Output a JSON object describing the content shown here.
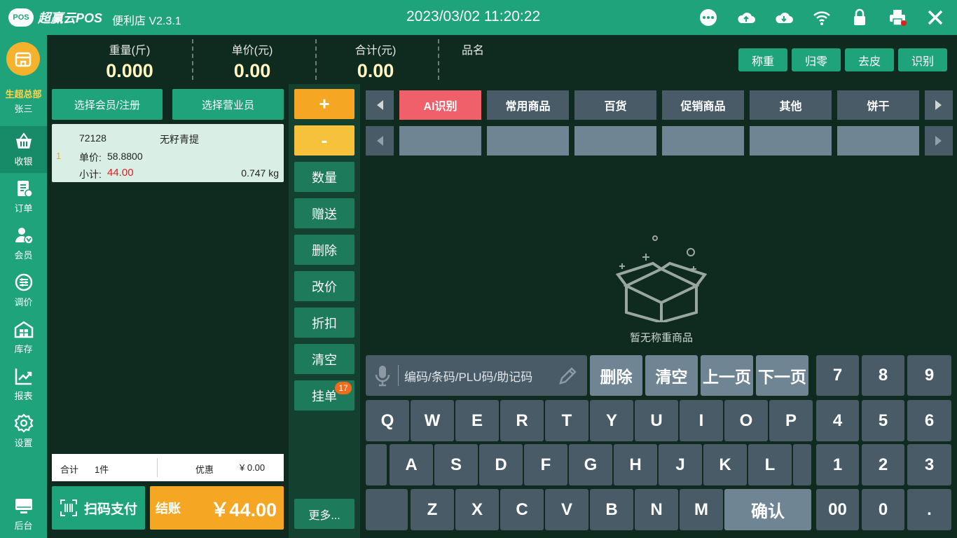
{
  "app": {
    "logo_badge": "POS",
    "name": "超赢云POS",
    "version": "便利店 V2.3.1",
    "datetime": "2023/03/02 11:20:22"
  },
  "topbar_icons": [
    "more-icon",
    "cloud-upload-icon",
    "cloud-download-icon",
    "wifi-icon",
    "lock-icon",
    "printer-icon",
    "close-icon"
  ],
  "sidebar": {
    "store": "生超总部",
    "user": "张三",
    "items": [
      {
        "label": "收银",
        "icon": "basket-icon",
        "active": true
      },
      {
        "label": "订单",
        "icon": "order-icon"
      },
      {
        "label": "会员",
        "icon": "member-icon"
      },
      {
        "label": "调价",
        "icon": "price-adjust-icon"
      },
      {
        "label": "库存",
        "icon": "inventory-icon"
      },
      {
        "label": "报表",
        "icon": "report-icon"
      },
      {
        "label": "设置",
        "icon": "settings-icon"
      },
      {
        "label": "后台",
        "icon": "backend-icon"
      }
    ]
  },
  "info": {
    "weight_label": "重量(斤)",
    "weight_value": "0.000",
    "unit_price_label": "单价(元)",
    "unit_price_value": "0.00",
    "total_label": "合计(元)",
    "total_value": "0.00",
    "product_label": "品名"
  },
  "scale_buttons": [
    "称重",
    "归零",
    "去皮",
    "识别"
  ],
  "left": {
    "select_member": "选择会员/注册",
    "select_staff": "选择营业员",
    "item": {
      "index": "1",
      "code": "72128",
      "name": "无籽青提",
      "unit_price_label": "单价:",
      "unit_price": "58.8800",
      "subtotal_label": "小计:",
      "subtotal": "44.00",
      "weight": "0.747 kg"
    },
    "summary": {
      "total_label": "合计",
      "count": "1件",
      "discount_label": "优惠",
      "discount": "¥ 0.00"
    },
    "scan_pay": "扫码支付",
    "checkout_label": "结账",
    "checkout_amount": "￥44.00"
  },
  "ops": {
    "plus": "+",
    "minus": "-",
    "quantity": "数量",
    "gift": "赠送",
    "delete": "删除",
    "change_price": "改价",
    "discount": "折扣",
    "clear": "清空",
    "hold": "挂单",
    "hold_count": "17",
    "more": "更多..."
  },
  "categories": [
    "AI识别",
    "常用商品",
    "百货",
    "促销商品",
    "其他",
    "饼干"
  ],
  "empty_text": "暂无称重商品",
  "search_placeholder": "编码/条码/PLU码/助记码",
  "fkeys": {
    "delete": "删除",
    "clear": "清空",
    "prev_page": "上一页",
    "next_page": "下一页"
  },
  "keyboard": {
    "row1": [
      "Q",
      "W",
      "E",
      "R",
      "T",
      "Y",
      "U",
      "I",
      "O",
      "P"
    ],
    "row2": [
      "A",
      "S",
      "D",
      "F",
      "G",
      "H",
      "J",
      "K",
      "L"
    ],
    "row3": [
      "Z",
      "X",
      "C",
      "V",
      "B",
      "N",
      "M"
    ],
    "confirm": "确认",
    "numpad": [
      "7",
      "8",
      "9",
      "4",
      "5",
      "6",
      "1",
      "2",
      "3",
      "00",
      "0",
      "."
    ]
  },
  "colors": {
    "brand": "#1fa37b",
    "orange": "#f5a623",
    "yellow": "#f7c23b",
    "key": "#4a5b68",
    "category_active": "#f0606a",
    "price_red": "#e02020"
  }
}
